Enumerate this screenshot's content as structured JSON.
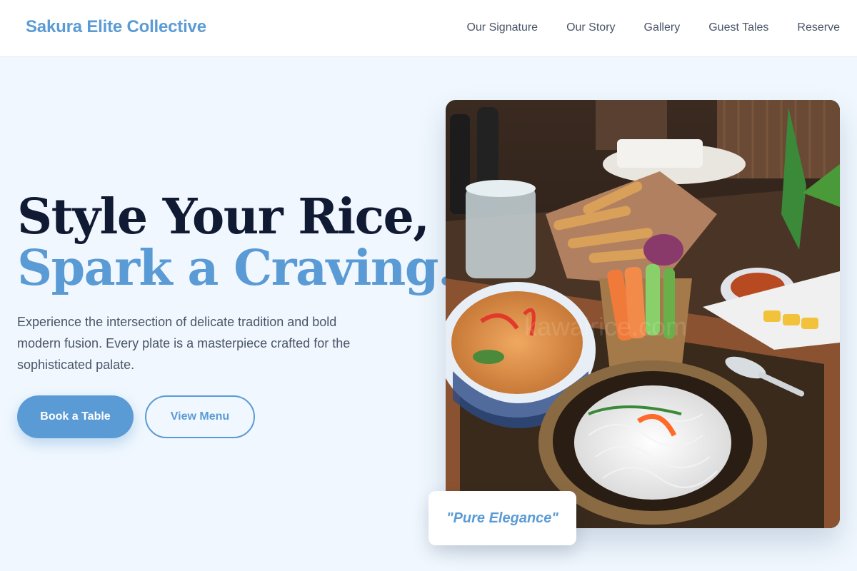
{
  "header": {
    "brand": "Sakura Elite Collective",
    "nav": [
      "Our Signature",
      "Our Story",
      "Gallery",
      "Guest Tales",
      "Reserve"
    ]
  },
  "hero": {
    "headline_line1": "Style Your Rice,",
    "headline_line2": "Spark a Craving.",
    "description": "Experience the intersection of delicate tradition and bold modern fusion. Every plate is a masterpiece crafted for the sophisticated palate.",
    "primary_button": "Book a Table",
    "secondary_button": "View Menu",
    "badge_text": "\"Pure Elegance\"",
    "image_watermark": "kawairice.com"
  },
  "colors": {
    "accent": "#5b9bd5",
    "heading_dark": "#101a33",
    "body_text": "#4a5568",
    "background": "#f0f7fe"
  },
  "icons": {
    "hero_image": "food-photo"
  }
}
